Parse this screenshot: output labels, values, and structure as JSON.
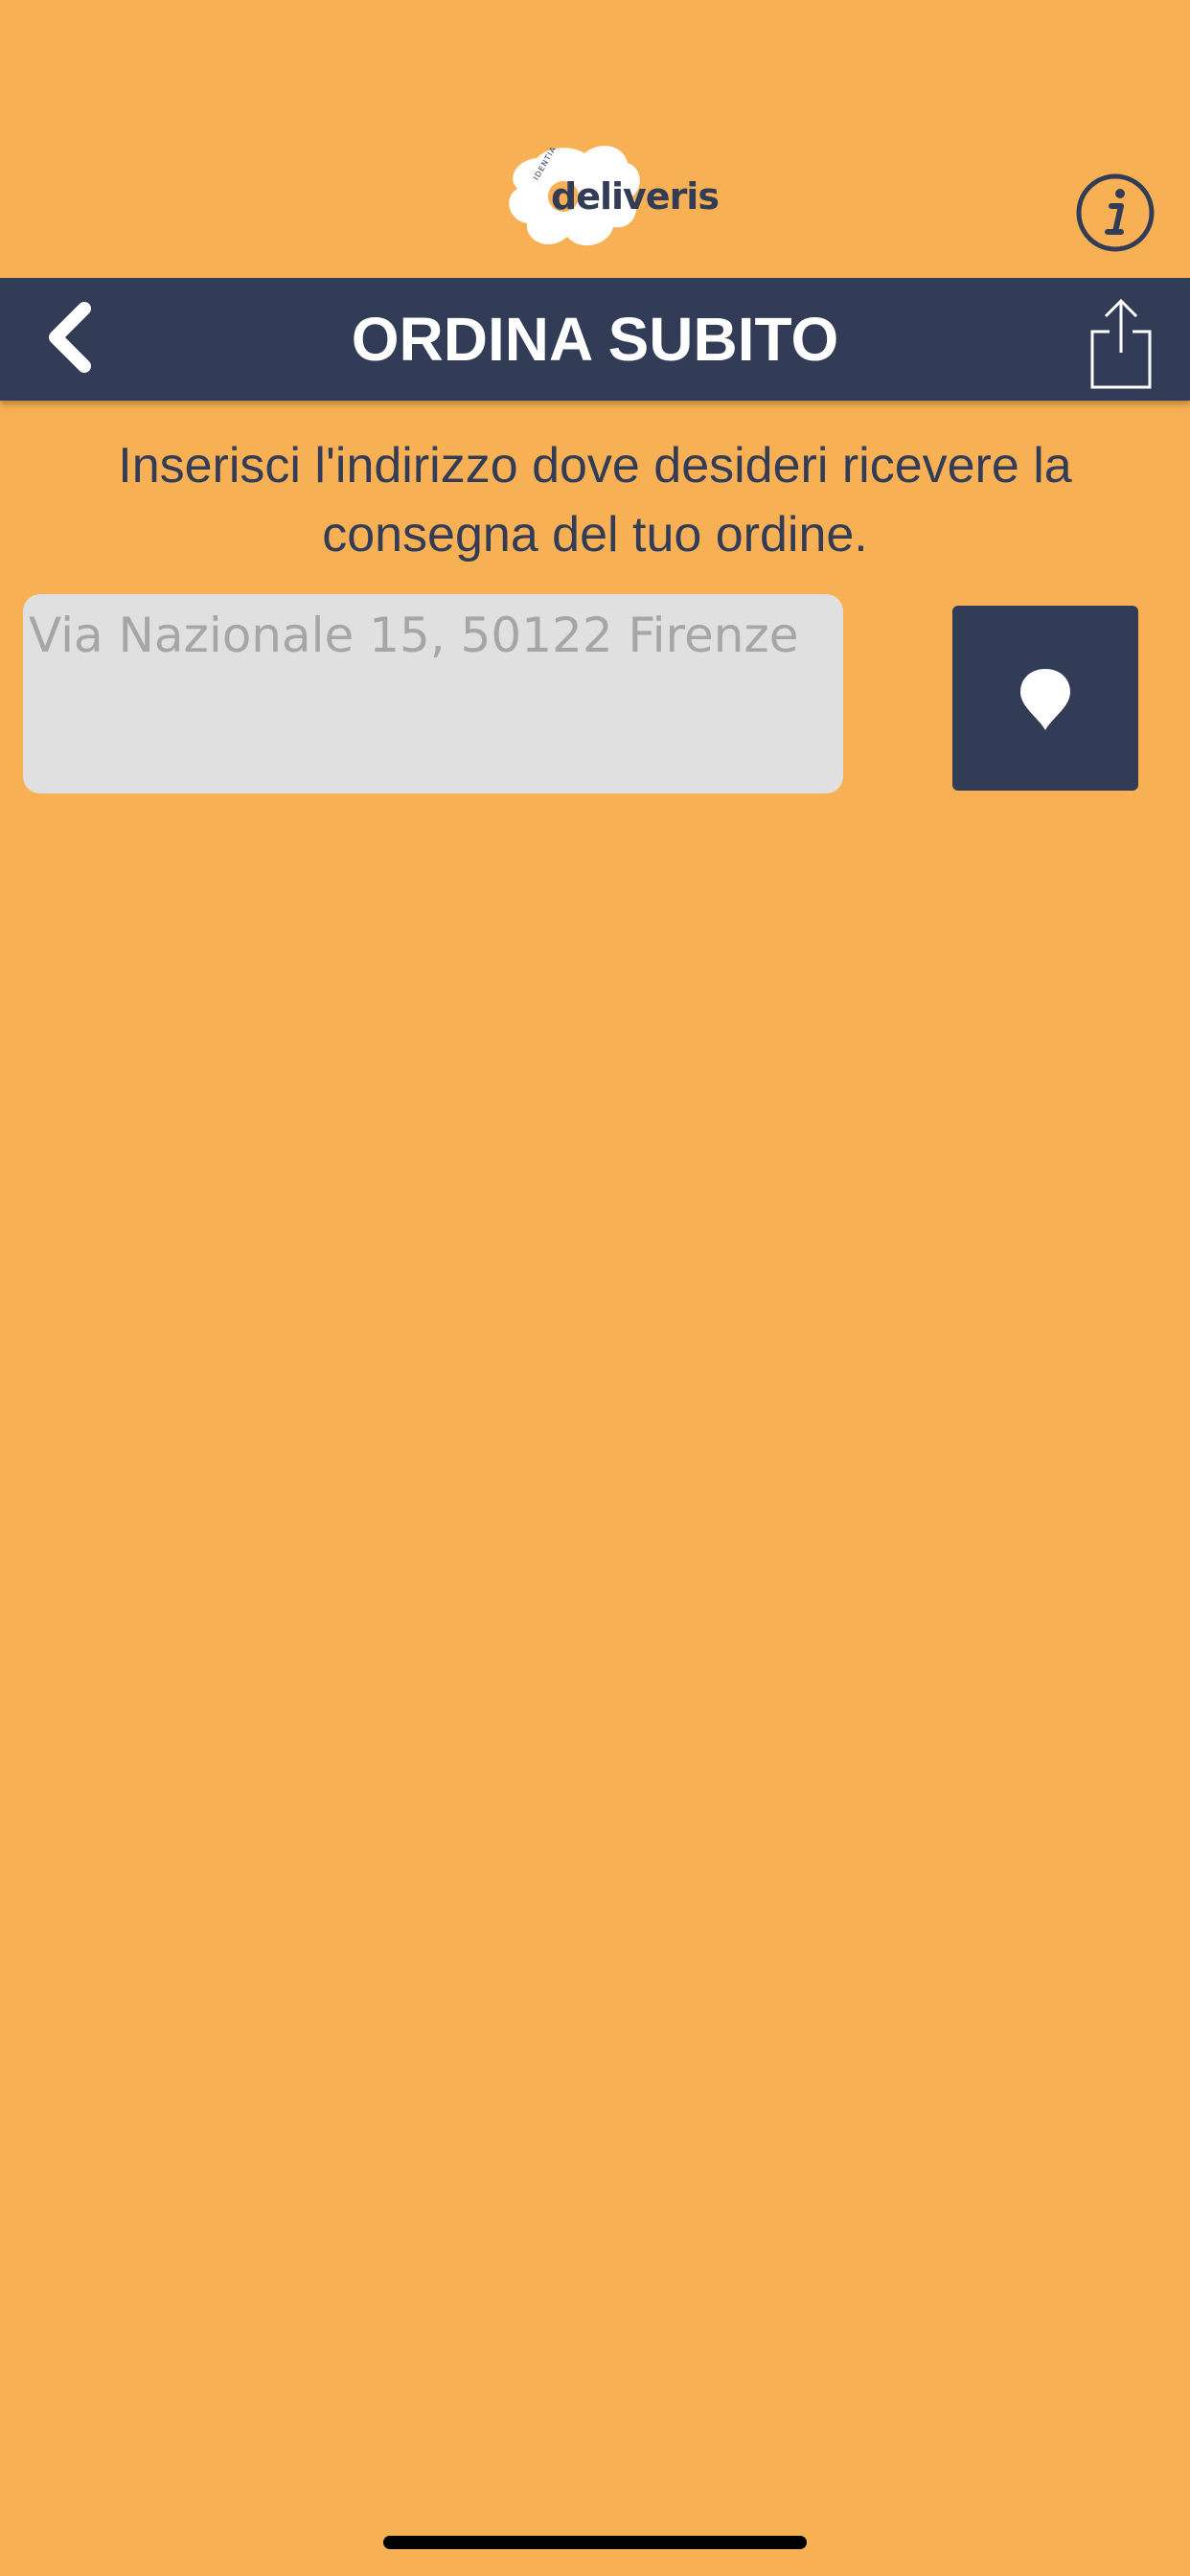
{
  "app": {
    "logo_text": "deliveris",
    "logo_small_text": "IDENTIA"
  },
  "navbar": {
    "title": "ORDINA SUBITO"
  },
  "main": {
    "instructions": "Inserisci l'indirizzo dove desideri ricevere la consegna del tuo ordine.",
    "address_input": {
      "placeholder": "Via Nazionale 15, 50122 Firenze",
      "value": ""
    }
  },
  "icons": {
    "info": "info-icon",
    "back": "chevron-left-icon",
    "share": "share-icon",
    "location": "location-pin-icon"
  },
  "colors": {
    "background": "#F7B054",
    "navbar": "#323C57",
    "text": "#323C57",
    "input_bg": "#E0E0E0",
    "placeholder": "#A6A6A6"
  }
}
